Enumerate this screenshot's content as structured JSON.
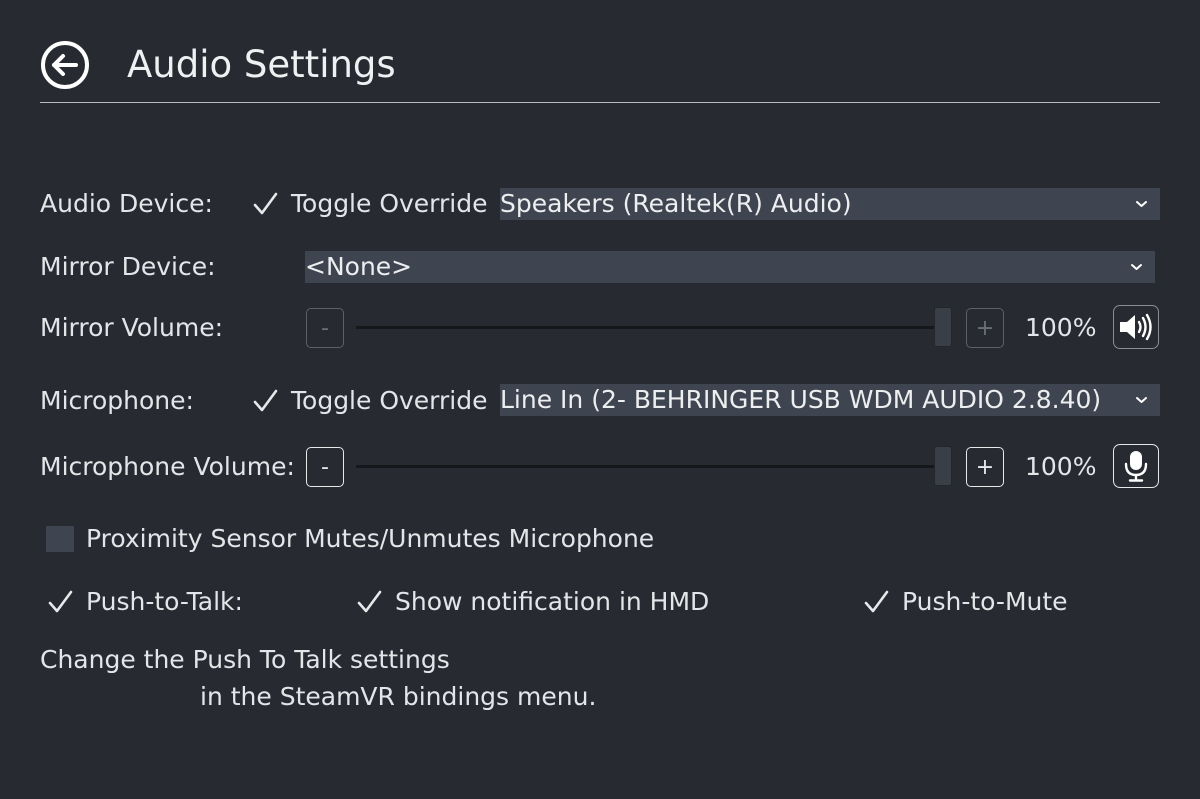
{
  "header": {
    "title": "Audio Settings",
    "back_icon": "arrow-left-circle-icon"
  },
  "audio_device": {
    "label": "Audio Device:",
    "override_checked": true,
    "override_label": "Toggle Override",
    "selected": "Speakers (Realtek(R) Audio)"
  },
  "mirror_device": {
    "label": "Mirror Device:",
    "selected": "<None>"
  },
  "mirror_volume": {
    "label": "Mirror Volume:",
    "minus": "-",
    "plus": "+",
    "value_text": "100%",
    "level": 1.0,
    "enabled": false,
    "icon": "speaker-volume-icon"
  },
  "microphone": {
    "label": "Microphone:",
    "override_checked": true,
    "override_label": "Toggle Override",
    "selected": "Line In (2- BEHRINGER USB WDM AUDIO 2.8.40)"
  },
  "microphone_volume": {
    "label": "Microphone Volume:",
    "minus": "-",
    "plus": "+",
    "value_text": "100%",
    "level": 1.0,
    "enabled": true,
    "icon": "microphone-icon"
  },
  "proximity": {
    "checked": false,
    "label": "Proximity Sensor Mutes/Unmutes Microphone"
  },
  "push_to_talk": {
    "checked": true,
    "label": "Push-to-Talk:"
  },
  "show_notification": {
    "checked": true,
    "label": "Show notification in HMD"
  },
  "push_to_mute": {
    "checked": true,
    "label": "Push-to-Mute"
  },
  "help": {
    "line1": "Change the Push To Talk settings",
    "line2": "in the SteamVR bindings menu."
  },
  "colors": {
    "background": "#272b31",
    "select_bg": "#3f4550",
    "text": "#e3e5e8"
  }
}
